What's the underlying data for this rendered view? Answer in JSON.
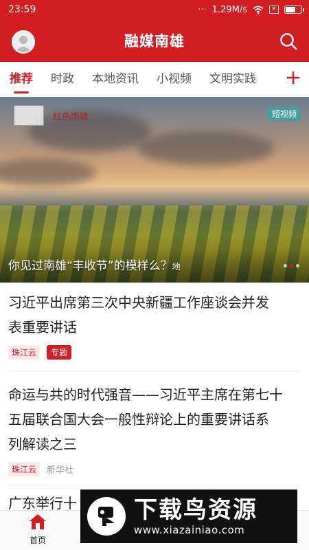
{
  "status_bar": {
    "time": "23:59",
    "dots": "···",
    "speed": "1.29M/s"
  },
  "header": {
    "title": "融媒南雄"
  },
  "tabs": [
    {
      "label": "推荐",
      "active": true
    },
    {
      "label": "时政"
    },
    {
      "label": "本地资讯"
    },
    {
      "label": "小视频"
    },
    {
      "label": "文明实践"
    }
  ],
  "hero": {
    "logo_text": "红色南雄",
    "badge": "短视频",
    "caption": "你见过南雄“丰收节”的模样么？",
    "caption_tail": "地",
    "slide_active": 2,
    "slide_count": 3
  },
  "news": [
    {
      "title_line1": "习近平出席第三次中央新疆工作座谈会并发",
      "title_line2": "表重要讲话",
      "source": "珠江云",
      "topic": "专题"
    },
    {
      "title_line1": "命运与共的时代强音——习近平主席在第七十",
      "title_line2": "五届联合国大会一般性辩论上的重要讲话系",
      "title_line3": "列解读之三",
      "source": "珠江云",
      "publisher": "新华社"
    },
    {
      "title_partial": "广东举行十"
    }
  ],
  "bottom_nav": {
    "home_label": "首页"
  },
  "watermark": {
    "title": "下载鸟资源",
    "url": "www.xiazainiao.com"
  },
  "colors": {
    "brand_red": "#d21e22"
  }
}
